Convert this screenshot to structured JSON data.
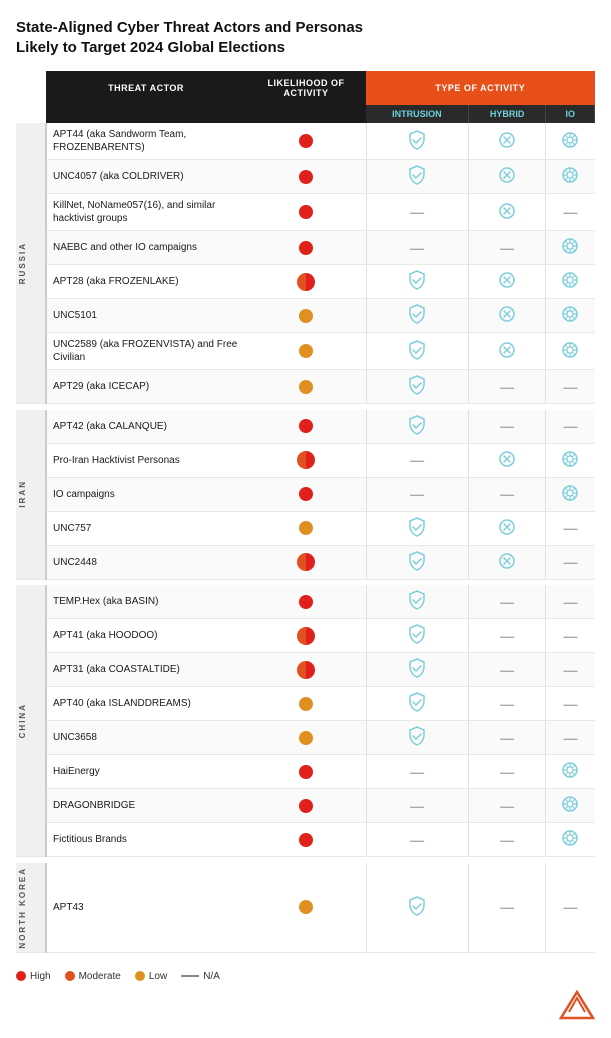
{
  "title": "State-Aligned Cyber Threat Actors and Personas\nLikely to Target 2024 Global Elections",
  "headers": {
    "threat_actor": "THREAT ACTOR",
    "likelihood": "LIKELIHOOD OF ACTIVITY",
    "type_of_activity": "TYPE OF ACTIVITY",
    "intrusion": "Intrusion",
    "hybrid": "Hybrid",
    "io": "IO"
  },
  "regions": [
    {
      "name": "RUSSIA",
      "rows": [
        {
          "actor": "APT44 (aka Sandworm Team, FROZENBARENTS)",
          "likelihood": "high",
          "intrusion": true,
          "hybrid": true,
          "io": true
        },
        {
          "actor": "UNC4057 (aka COLDRIVER)",
          "likelihood": "high",
          "intrusion": true,
          "hybrid": true,
          "io": true
        },
        {
          "actor": "KillNet, NoName057(16), and similar hacktivist groups",
          "likelihood": "high",
          "intrusion": false,
          "hybrid": true,
          "io": false
        },
        {
          "actor": "NAEBC and other IO campaigns",
          "likelihood": "high",
          "intrusion": false,
          "hybrid": false,
          "io": true
        },
        {
          "actor": "APT28 (aka FROZENLAKE)",
          "likelihood": "moderate-high",
          "intrusion": true,
          "hybrid": true,
          "io": true
        },
        {
          "actor": "UNC5101",
          "likelihood": "low",
          "intrusion": true,
          "hybrid": true,
          "io": true
        },
        {
          "actor": "UNC2589 (aka FROZENVISTA) and Free Civilian",
          "likelihood": "low",
          "intrusion": true,
          "hybrid": true,
          "io": true
        },
        {
          "actor": "APT29 (aka ICECAP)",
          "likelihood": "low",
          "intrusion": true,
          "hybrid": false,
          "io": false
        }
      ]
    },
    {
      "name": "IRAN",
      "rows": [
        {
          "actor": "APT42 (aka CALANQUE)",
          "likelihood": "high",
          "intrusion": true,
          "hybrid": false,
          "io": false
        },
        {
          "actor": "Pro-Iran Hacktivist Personas",
          "likelihood": "moderate-high",
          "intrusion": false,
          "hybrid": true,
          "io": true
        },
        {
          "actor": "IO campaigns",
          "likelihood": "high",
          "intrusion": false,
          "hybrid": false,
          "io": true
        },
        {
          "actor": "UNC757",
          "likelihood": "low",
          "intrusion": true,
          "hybrid": true,
          "io": false
        },
        {
          "actor": "UNC2448",
          "likelihood": "moderate-high",
          "intrusion": true,
          "hybrid": true,
          "io": false
        }
      ]
    },
    {
      "name": "CHINA",
      "rows": [
        {
          "actor": "TEMP.Hex (aka BASIN)",
          "likelihood": "high",
          "intrusion": true,
          "hybrid": false,
          "io": false
        },
        {
          "actor": "APT41 (aka HOODOO)",
          "likelihood": "moderate-high",
          "intrusion": true,
          "hybrid": false,
          "io": false
        },
        {
          "actor": "APT31 (aka COASTALTIDE)",
          "likelihood": "moderate-high",
          "intrusion": true,
          "hybrid": false,
          "io": false
        },
        {
          "actor": "APT40 (aka ISLANDDREAMS)",
          "likelihood": "low",
          "intrusion": true,
          "hybrid": false,
          "io": false
        },
        {
          "actor": "UNC3658",
          "likelihood": "low",
          "intrusion": true,
          "hybrid": false,
          "io": false
        },
        {
          "actor": "HaiEnergy",
          "likelihood": "high",
          "intrusion": false,
          "hybrid": false,
          "io": true
        },
        {
          "actor": "DRAGONBRIDGE",
          "likelihood": "high",
          "intrusion": false,
          "hybrid": false,
          "io": true
        },
        {
          "actor": "Fictitious Brands",
          "likelihood": "high",
          "intrusion": false,
          "hybrid": false,
          "io": true
        }
      ]
    },
    {
      "name": "NORTH KOREA",
      "rows": [
        {
          "actor": "APT43",
          "likelihood": "low",
          "intrusion": true,
          "hybrid": false,
          "io": false
        }
      ]
    }
  ],
  "legend": {
    "high_label": "High",
    "moderate_label": "Moderate",
    "low_label": "Low",
    "na_label": "N/A"
  },
  "colors": {
    "high": "#e0201a",
    "moderate": "#e05020",
    "low": "#e09020",
    "na": "#999999",
    "icon_color": "#7ecfdb",
    "header_bg": "#1a1a1a",
    "type_header_bg": "#e8501a"
  }
}
